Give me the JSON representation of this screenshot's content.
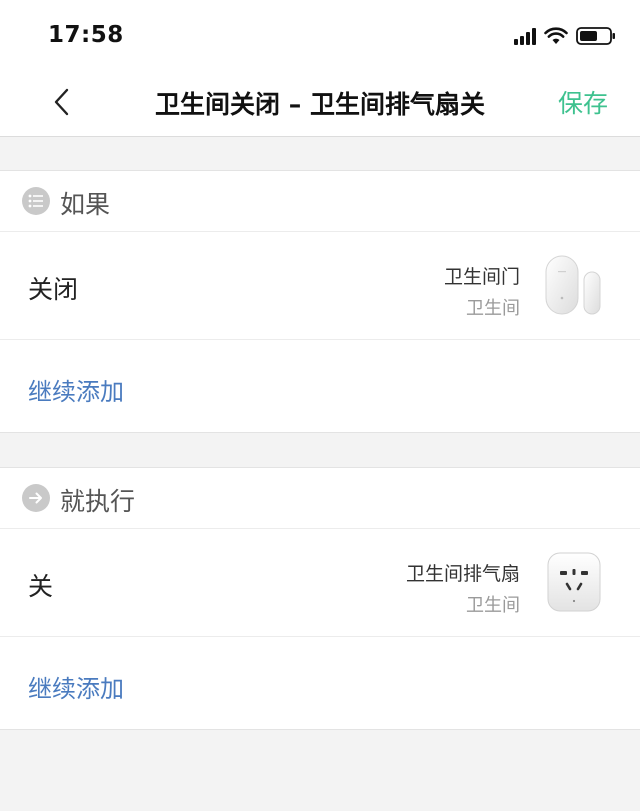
{
  "status_bar": {
    "time": "17:58"
  },
  "nav": {
    "title": "卫生间关闭 – 卫生间排气扇关",
    "save_label": "保存"
  },
  "if_section": {
    "header": "如果",
    "condition": {
      "label": "关闭",
      "device_name": "卫生间门",
      "device_room": "卫生间"
    },
    "add_label": "继续添加"
  },
  "then_section": {
    "header": "就执行",
    "action": {
      "label": "关",
      "device_name": "卫生间排气扇",
      "device_room": "卫生间"
    },
    "add_label": "继续添加"
  },
  "colors": {
    "accent_green": "#3ec28f",
    "link_blue": "#4a7bbf",
    "background": "#f3f3f3"
  },
  "icons": {
    "back": "chevron-left-icon",
    "if_header": "list-icon",
    "then_header": "arrow-right-icon",
    "condition_device": "door-sensor-icon",
    "action_device": "smart-plug-icon"
  }
}
